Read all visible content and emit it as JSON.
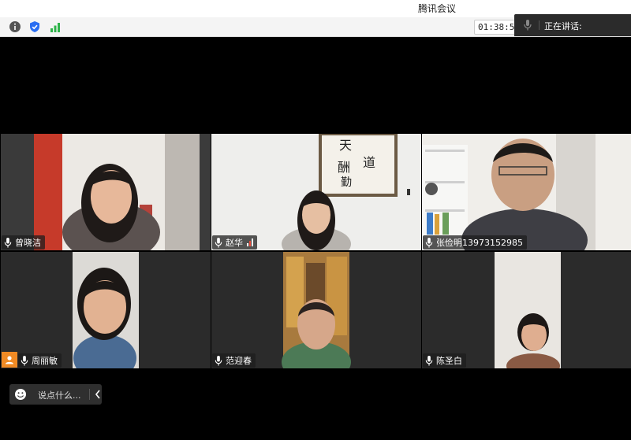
{
  "window": {
    "title": "腾讯会议"
  },
  "toolbar": {
    "icons": [
      "info-icon",
      "shield-icon",
      "signal-icon"
    ],
    "timer": "01:38:58",
    "speaking_label": "正在讲话:"
  },
  "participants": [
    {
      "name": "曾晓洁"
    },
    {
      "name": "赵华"
    },
    {
      "name": "张俭明13973152985"
    },
    {
      "name": "周丽敏"
    },
    {
      "name": "范迎春"
    },
    {
      "name": "陈圣白"
    }
  ],
  "chat": {
    "placeholder": "说点什么..."
  },
  "colors": {
    "background": "#000000",
    "tile": "#2b2b2b",
    "accent_orange": "#f08a24",
    "signal_green": "#2eb44a",
    "shield_blue": "#2a6ef2"
  }
}
